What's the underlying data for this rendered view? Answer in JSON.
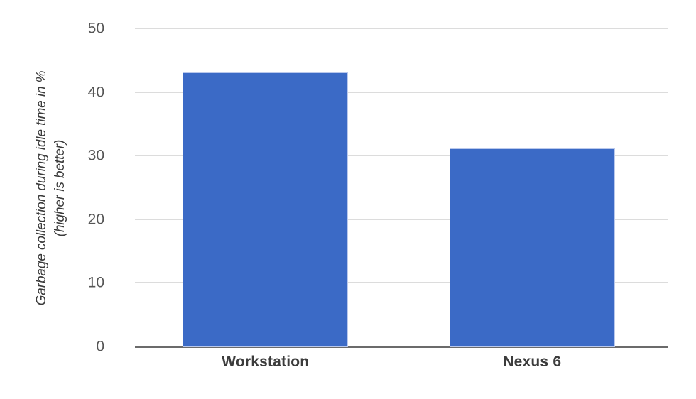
{
  "chart_data": {
    "type": "bar",
    "title": "",
    "subtitle": "",
    "categories": [
      "Workstation",
      "Nexus 6"
    ],
    "values": [
      43,
      31
    ],
    "series": [
      {
        "name": "Garbage collection during idle time in %",
        "values": [
          43,
          31
        ],
        "color": "#3b6ac6"
      }
    ],
    "xlabel": "",
    "ylabel": "Garbage collection during idle time in % (higher is better)",
    "ylabel_lines": [
      "Garbage collection during idle time in %",
      "(higher is better)"
    ],
    "ylim": [
      0,
      50
    ],
    "ytick_values": [
      50,
      40,
      30,
      20,
      10,
      0
    ],
    "yticks": [
      "50",
      "40",
      "30",
      "20",
      "10",
      "0"
    ],
    "grid": true,
    "grid_axis": "y",
    "legend": false,
    "legend_position": "none",
    "annotations": [],
    "colors": {
      "bar": "#3b6ac6",
      "bar_border": "#b9c8ec",
      "gridline": "#dcdcdc",
      "axis_line": "#6b6b6b",
      "tick_label": "#555555",
      "category_label": "#3c3c3c",
      "axis_title": "#3a3a3a",
      "background": "#ffffff"
    }
  }
}
